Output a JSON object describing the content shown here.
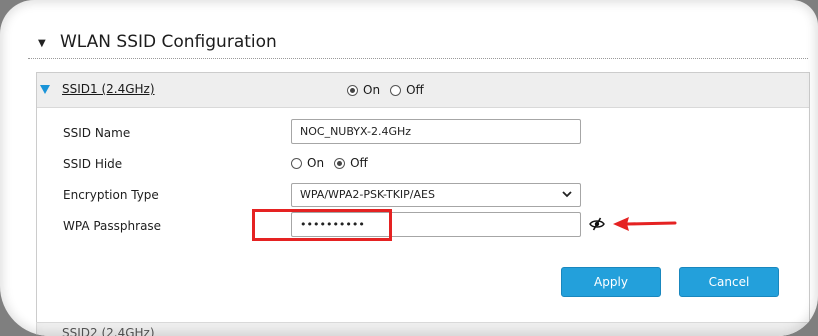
{
  "section": {
    "toggle_icon": "triangle-down-icon",
    "title": "WLAN SSID Configuration"
  },
  "ssid1": {
    "header_link": "SSID1 (2.4GHz)",
    "on_label": "On",
    "off_label": "Off",
    "enabled": "On"
  },
  "form": {
    "ssid_name_label": "SSID Name",
    "ssid_name_value": "NOC_NUBYX-2.4GHz",
    "ssid_hide_label": "SSID Hide",
    "hide_on_label": "On",
    "hide_off_label": "Off",
    "hide_selected": "Off",
    "encryption_label": "Encryption Type",
    "encryption_value": "WPA/WPA2-PSK-TKIP/AES",
    "passphrase_label": "WPA Passphrase",
    "passphrase_value": "••••••••••",
    "show_password_icon": "eye-slash-icon"
  },
  "buttons": {
    "apply": "Apply",
    "cancel": "Cancel"
  },
  "next_section": {
    "header_link": "SSID2 (2.4GHz)"
  },
  "annotation": {
    "highlight_color": "#e52222",
    "arrow_icon": "red-arrow-left-icon"
  },
  "colors": {
    "accent_blue": "#23a0db",
    "panel_header": "#eeeeee"
  }
}
